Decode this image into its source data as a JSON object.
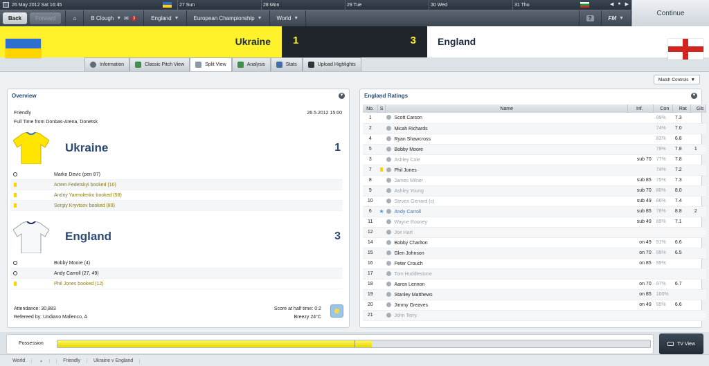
{
  "topbar": {
    "date_label": "26 May 2012 Sat 16:45",
    "days": [
      "27 Sun",
      "28 Mon",
      "29 Tue",
      "30 Wed",
      "31 Thu"
    ]
  },
  "nav": {
    "back": "Back",
    "forward": "Forward",
    "manager": "B Clough",
    "inbox_count": "3",
    "items": [
      "England",
      "European Championship",
      "World"
    ],
    "fm_label": "FM",
    "help": "?",
    "continue": "Continue"
  },
  "match": {
    "home_team": "Ukraine",
    "away_team": "England",
    "home_score": "1",
    "away_score": "3"
  },
  "tabs": [
    "Information",
    "Classic Pitch View",
    "Split View",
    "Analysis",
    "Stats",
    "Upload Highlights"
  ],
  "active_tab": "Split View",
  "match_controls": "Match Controls",
  "overview": {
    "title": "Overview",
    "competition": "Friendly",
    "date_time": "26.5.2012 15:00",
    "status": "Full Time from Donbas-Arena, Donetsk",
    "home": {
      "name": "Ukraine",
      "score": "1",
      "events": [
        {
          "type": "goal",
          "text": "Marko Devic (pen 87)"
        },
        {
          "type": "booking",
          "text": "Artem Fedetskyi booked (10)"
        },
        {
          "type": "booking",
          "text": "Andriy Yarmolenko booked (58)"
        },
        {
          "type": "booking",
          "text": "Sergiy Kryvtsov booked (89)"
        }
      ]
    },
    "away": {
      "name": "England",
      "score": "3",
      "events": [
        {
          "type": "goal",
          "text": "Bobby Moore (4)"
        },
        {
          "type": "goal",
          "text": "Andy Carroll (27, 49)"
        },
        {
          "type": "booking",
          "text": "Phil Jones booked (12)"
        }
      ]
    },
    "attendance": "Attendance: 30,883",
    "referee": "Refereed by: Undiano Mallenco, A",
    "halftime": "Score at half time: 0:2",
    "weather": "Breezy 24°C"
  },
  "ratings": {
    "title": "England Ratings",
    "columns": [
      "No.",
      "S",
      "Name",
      "Inf.",
      "Con",
      "Rat",
      "Gls"
    ],
    "rows": [
      {
        "no": "1",
        "s": "",
        "name": "Scott Carson",
        "inf": "",
        "con": "99%",
        "rat": "7.3",
        "gls": "",
        "style": "normal"
      },
      {
        "no": "2",
        "s": "",
        "name": "Micah Richards",
        "inf": "",
        "con": "74%",
        "rat": "7.0",
        "gls": "",
        "style": "normal"
      },
      {
        "no": "4",
        "s": "",
        "name": "Ryan Shawcross",
        "inf": "",
        "con": "83%",
        "rat": "6.8",
        "gls": "",
        "style": "normal"
      },
      {
        "no": "5",
        "s": "",
        "name": "Bobby Moore",
        "inf": "",
        "con": "79%",
        "rat": "7.8",
        "gls": "1",
        "style": "normal"
      },
      {
        "no": "3",
        "s": "",
        "name": "Ashley Cole",
        "inf": "sub 70",
        "con": "77%",
        "rat": "7.8",
        "gls": "",
        "style": "sub"
      },
      {
        "no": "7",
        "s": "card",
        "name": "Phil Jones",
        "inf": "",
        "con": "74%",
        "rat": "7.2",
        "gls": "",
        "style": "normal"
      },
      {
        "no": "8",
        "s": "",
        "name": "James Milner",
        "inf": "sub 85",
        "con": "75%",
        "rat": "7.3",
        "gls": "",
        "style": "sub"
      },
      {
        "no": "9",
        "s": "",
        "name": "Ashley Young",
        "inf": "sub 70",
        "con": "80%",
        "rat": "8.0",
        "gls": "",
        "style": "sub"
      },
      {
        "no": "10",
        "s": "",
        "name": "Steven Gerrard (c)",
        "inf": "sub 49",
        "con": "86%",
        "rat": "7.4",
        "gls": "",
        "style": "sub"
      },
      {
        "no": "6",
        "s": "star",
        "name": "Andy Carroll",
        "inf": "sub 85",
        "con": "76%",
        "rat": "8.8",
        "gls": "2",
        "style": "star"
      },
      {
        "no": "11",
        "s": "",
        "name": "Wayne Rooney",
        "inf": "sub 49",
        "con": "89%",
        "rat": "7.1",
        "gls": "",
        "style": "sub"
      },
      {
        "no": "12",
        "s": "",
        "name": "Joe Hart",
        "inf": "",
        "con": "",
        "rat": "",
        "gls": "",
        "style": "sub"
      },
      {
        "no": "14",
        "s": "",
        "name": "Bobby Charlton",
        "inf": "on 49",
        "con": "91%",
        "rat": "6.6",
        "gls": "",
        "style": "normal"
      },
      {
        "no": "15",
        "s": "",
        "name": "Glen Johnson",
        "inf": "on 70",
        "con": "99%",
        "rat": "6.5",
        "gls": "",
        "style": "normal"
      },
      {
        "no": "16",
        "s": "",
        "name": "Peter Crouch",
        "inf": "on 85",
        "con": "99%",
        "rat": "",
        "gls": "",
        "style": "normal"
      },
      {
        "no": "17",
        "s": "",
        "name": "Tom Huddlestone",
        "inf": "",
        "con": "",
        "rat": "",
        "gls": "",
        "style": "sub"
      },
      {
        "no": "18",
        "s": "",
        "name": "Aaron Lennon",
        "inf": "on 70",
        "con": "97%",
        "rat": "6.7",
        "gls": "",
        "style": "normal"
      },
      {
        "no": "19",
        "s": "",
        "name": "Stanley Matthews",
        "inf": "on 85",
        "con": "100%",
        "rat": "",
        "gls": "",
        "style": "normal"
      },
      {
        "no": "20",
        "s": "",
        "name": "Jimmy Greaves",
        "inf": "on 49",
        "con": "95%",
        "rat": "6.6",
        "gls": "",
        "style": "normal"
      },
      {
        "no": "21",
        "s": "",
        "name": "John Terry",
        "inf": "",
        "con": "",
        "rat": "",
        "gls": "",
        "style": "sub"
      }
    ]
  },
  "possession": {
    "label": "Possession",
    "home_fraction": 0.53
  },
  "tv_view": "TV View",
  "footer": {
    "crumbs": [
      "World",
      "Friendly",
      "Ukraine v England"
    ]
  },
  "colors": {
    "home_yellow": "#fff22a",
    "score_bg": "#1f252b",
    "accent_blue": "#2b4a73",
    "booking_text": "#8a7a0c"
  }
}
